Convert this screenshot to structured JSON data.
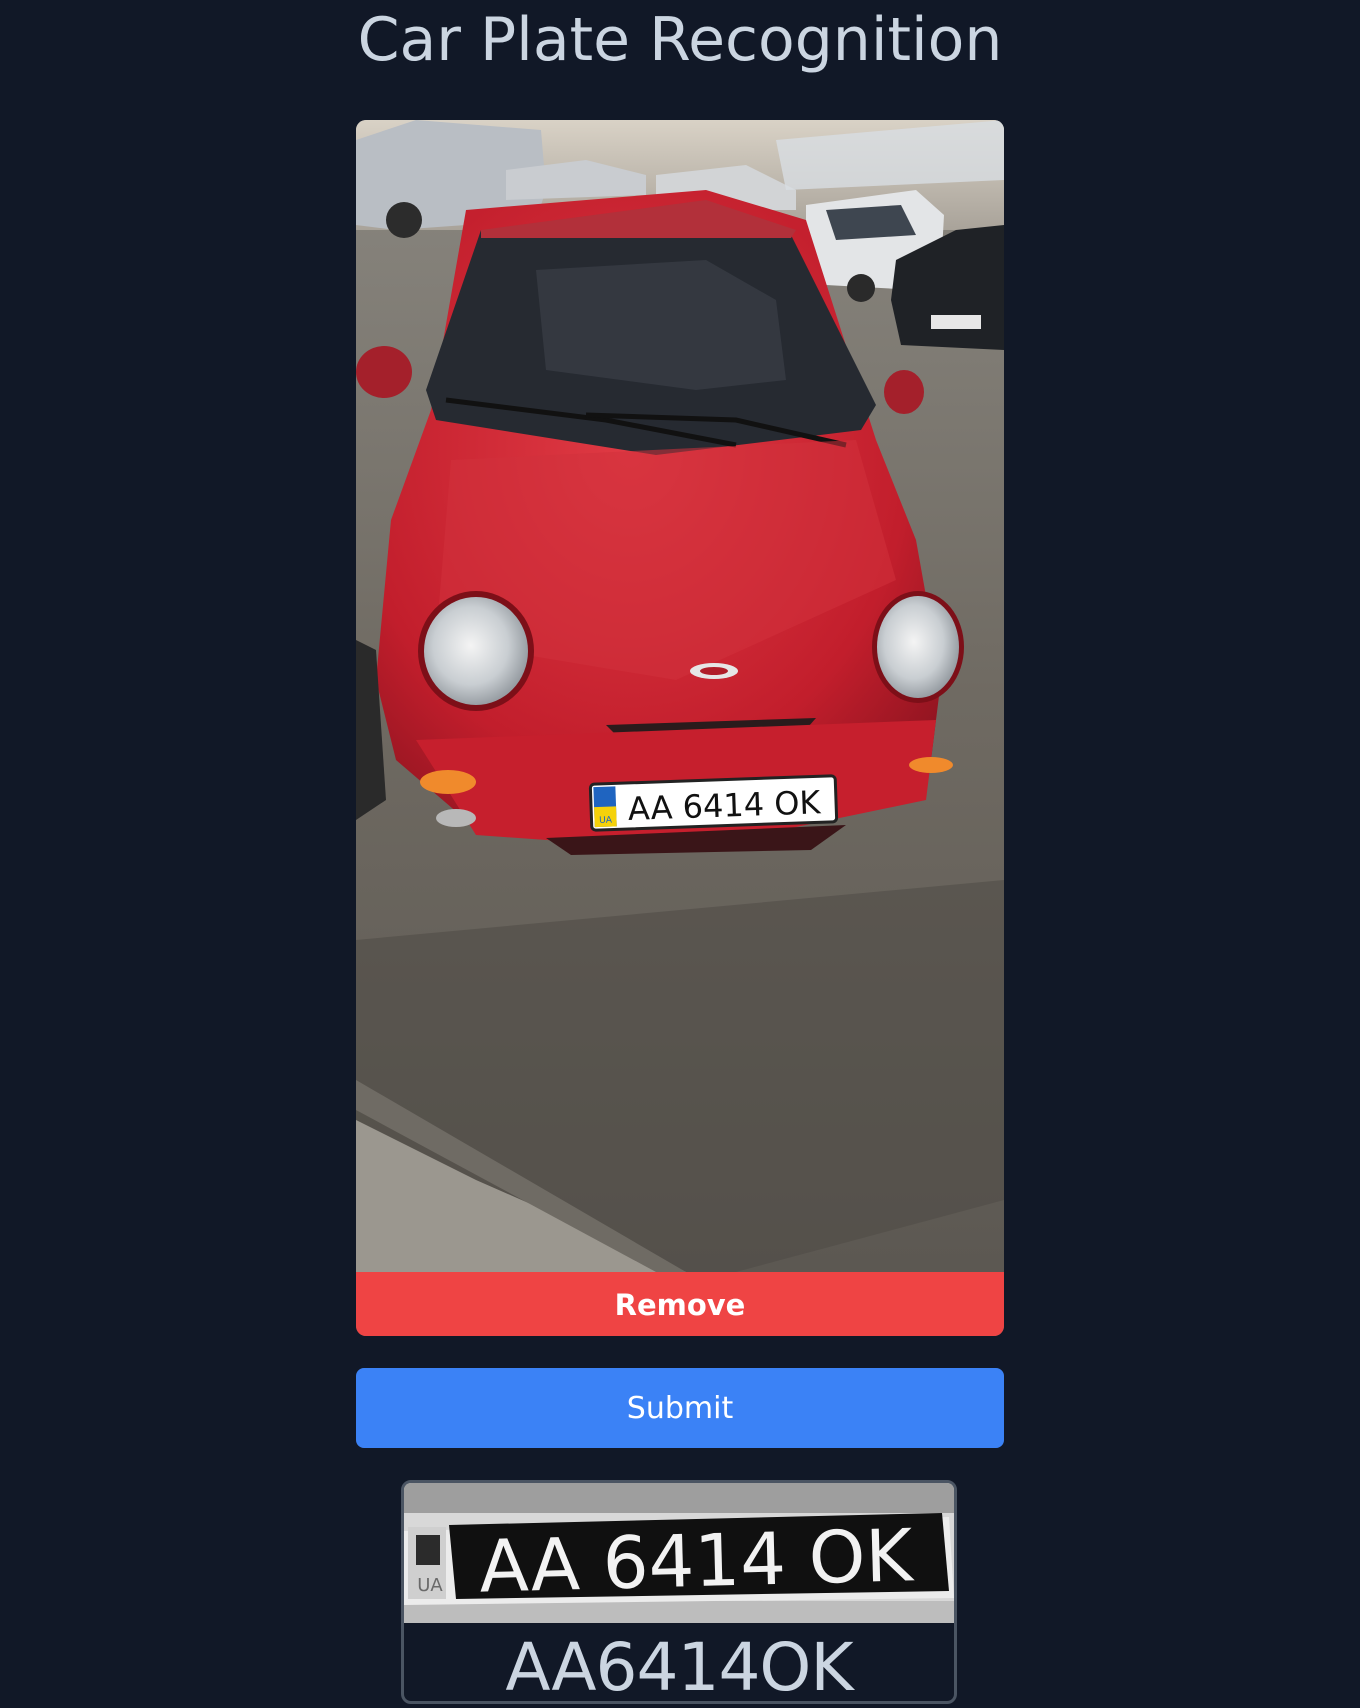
{
  "header": {
    "title": "Car Plate Recognition"
  },
  "upload": {
    "remove_label": "Remove",
    "photo_plate_text": "AA 6414 OK",
    "photo_plate_country": "UA"
  },
  "actions": {
    "submit_label": "Submit"
  },
  "result": {
    "crop_plate_text": "AA 6414 OK",
    "crop_plate_country": "UA",
    "recognized_text": "AA6414OK"
  },
  "colors": {
    "background": "#111827",
    "remove": "#ef4444",
    "submit": "#3b82f6",
    "text": "#cbd5e1"
  }
}
